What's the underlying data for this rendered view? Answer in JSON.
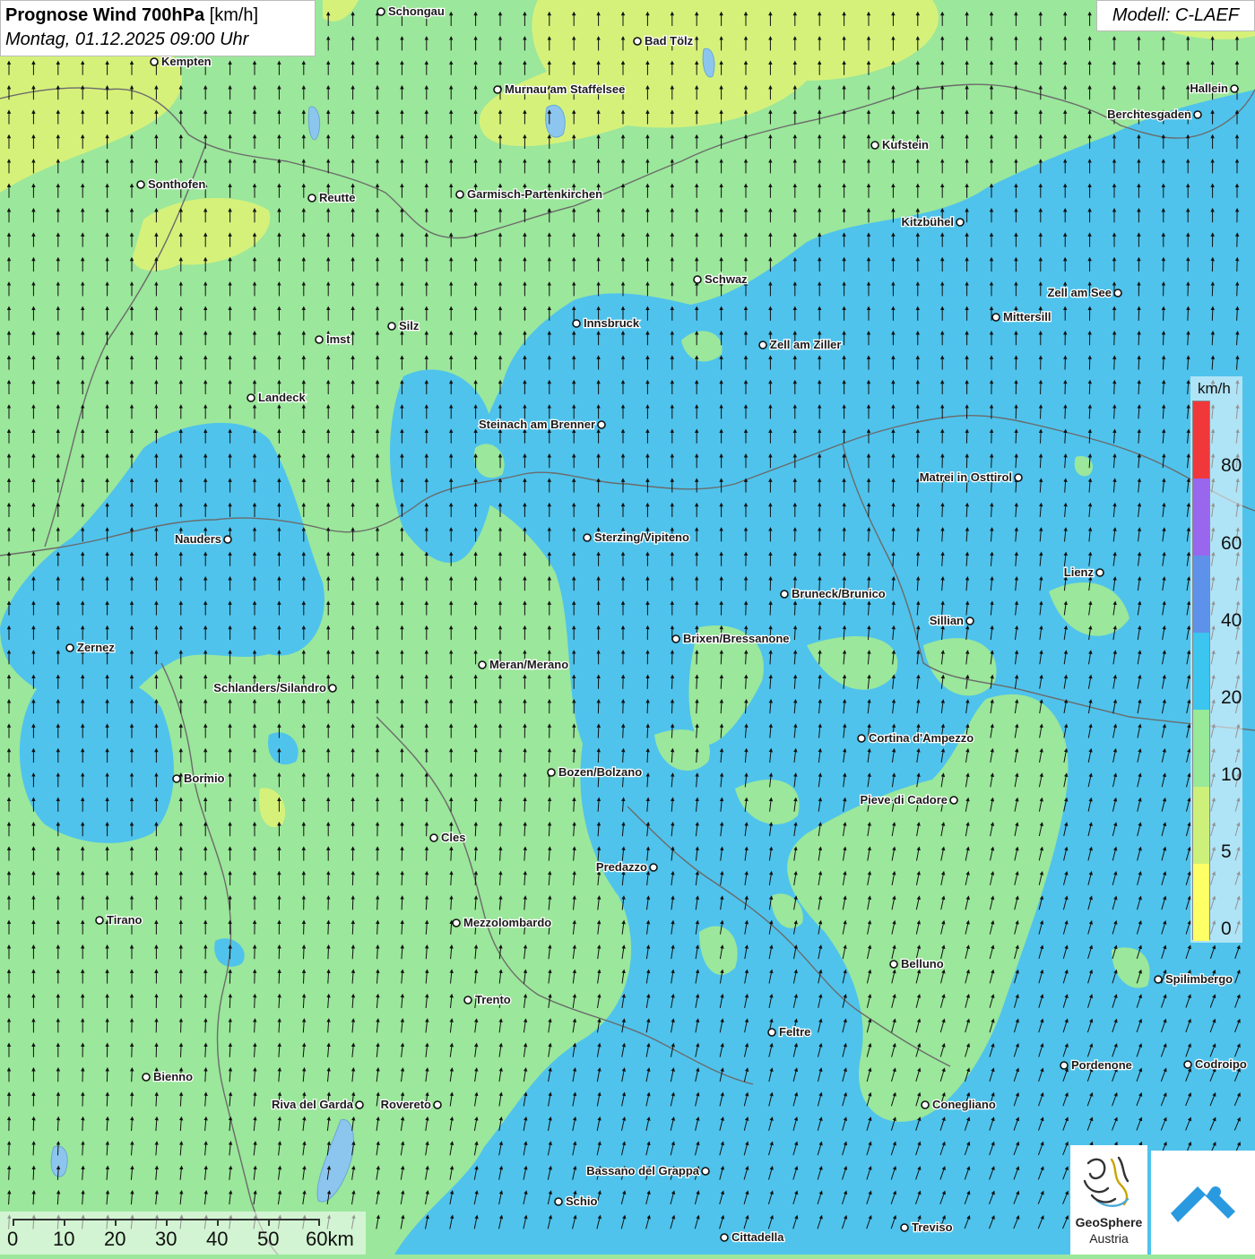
{
  "title": {
    "main": "Prognose Wind 700hPa",
    "unit": "[km/h]",
    "datetime": "Montag, 01.12.2025 09:00 Uhr"
  },
  "model": "Modell: C-LAEF",
  "legend": {
    "unit": "km/h",
    "ticks": [
      "80",
      "60",
      "40",
      "20",
      "10",
      "5",
      "0"
    ],
    "colors": [
      "#f0383a",
      "#9966ee",
      "#5e92ea",
      "#3cc5ef",
      "#98e998",
      "#cdf07a",
      "#ffff66"
    ]
  },
  "scale": {
    "labels": [
      "0",
      "10",
      "20",
      "30",
      "40",
      "50",
      "60km"
    ]
  },
  "map_colors": {
    "calm_yellow": "#d6f17a",
    "light_green": "#9be79b",
    "cyan_blue": "#4fc3ec",
    "border_gray": "#6b6b6b",
    "lake_blue": "#8cc6ee"
  },
  "wind_direction": "south-to-north (arrows pointing north, turning north-east in the south-east)",
  "cities": [
    "Schongau",
    "Bad Tölz",
    "Kempten",
    "Murnau am Staffelsee",
    "Hallein",
    "Berchtesgaden",
    "Kufstein",
    "Sonthofen",
    "Reutte",
    "Garmisch-Partenkirchen",
    "Kitzbühel",
    "Schwaz",
    "Zell am See",
    "Mittersill",
    "Innsbruck",
    "Silz",
    "Imst",
    "Zell am Ziller",
    "Landeck",
    "Steinach am Brenner",
    "Matrei in Osttirol",
    "Nauders",
    "Sterzing/Vipiteno",
    "Lienz",
    "Bruneck/Brunico",
    "Sillian",
    "Brixen/Bressanone",
    "Zernez",
    "Meran/Merano",
    "Schlanders/Silandro",
    "Cortina d'Ampezzo",
    "Bozen/Bolzano",
    "Bormio",
    "Pieve di Cadore",
    "Cles",
    "Predazzo",
    "Tirano",
    "Mezzolombardo",
    "Belluno",
    "Spilimbergo",
    "Trento",
    "Feltre",
    "Pordenone",
    "Codroipo",
    "Bienno",
    "Riva del Garda",
    "Rovereto",
    "Conegliano",
    "Bassano del Grappa",
    "Schio",
    "Treviso",
    "Cittadella"
  ],
  "logo": {
    "name": "GeoSphere",
    "sub": "Austria"
  }
}
